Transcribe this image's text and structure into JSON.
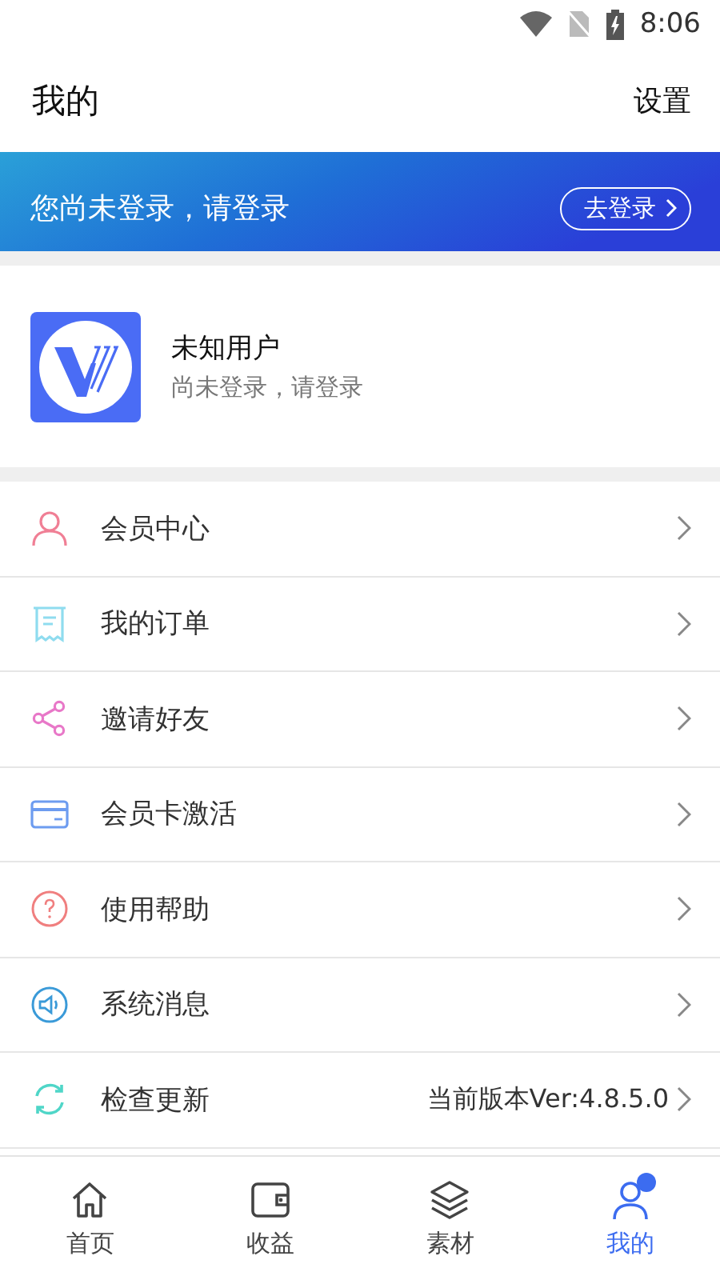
{
  "status_bar": {
    "time": "8:06"
  },
  "header": {
    "title": "我的",
    "action": "设置"
  },
  "banner": {
    "text": "您尚未登录，请登录",
    "button": "去登录"
  },
  "profile": {
    "name": "未知用户",
    "subtitle": "尚未登录，请登录"
  },
  "menu": [
    {
      "label": "会员中心"
    },
    {
      "label": "我的订单"
    },
    {
      "label": "邀请好友"
    },
    {
      "label": "会员卡激活"
    },
    {
      "label": "使用帮助"
    },
    {
      "label": "系统消息"
    },
    {
      "label": "检查更新",
      "value": "当前版本Ver:4.8.5.0"
    }
  ],
  "tabs": [
    {
      "label": "首页",
      "selected": false,
      "badge": false
    },
    {
      "label": "收益",
      "selected": false,
      "badge": false
    },
    {
      "label": "素材",
      "selected": false,
      "badge": false
    },
    {
      "label": "我的",
      "selected": true,
      "badge": true
    }
  ]
}
